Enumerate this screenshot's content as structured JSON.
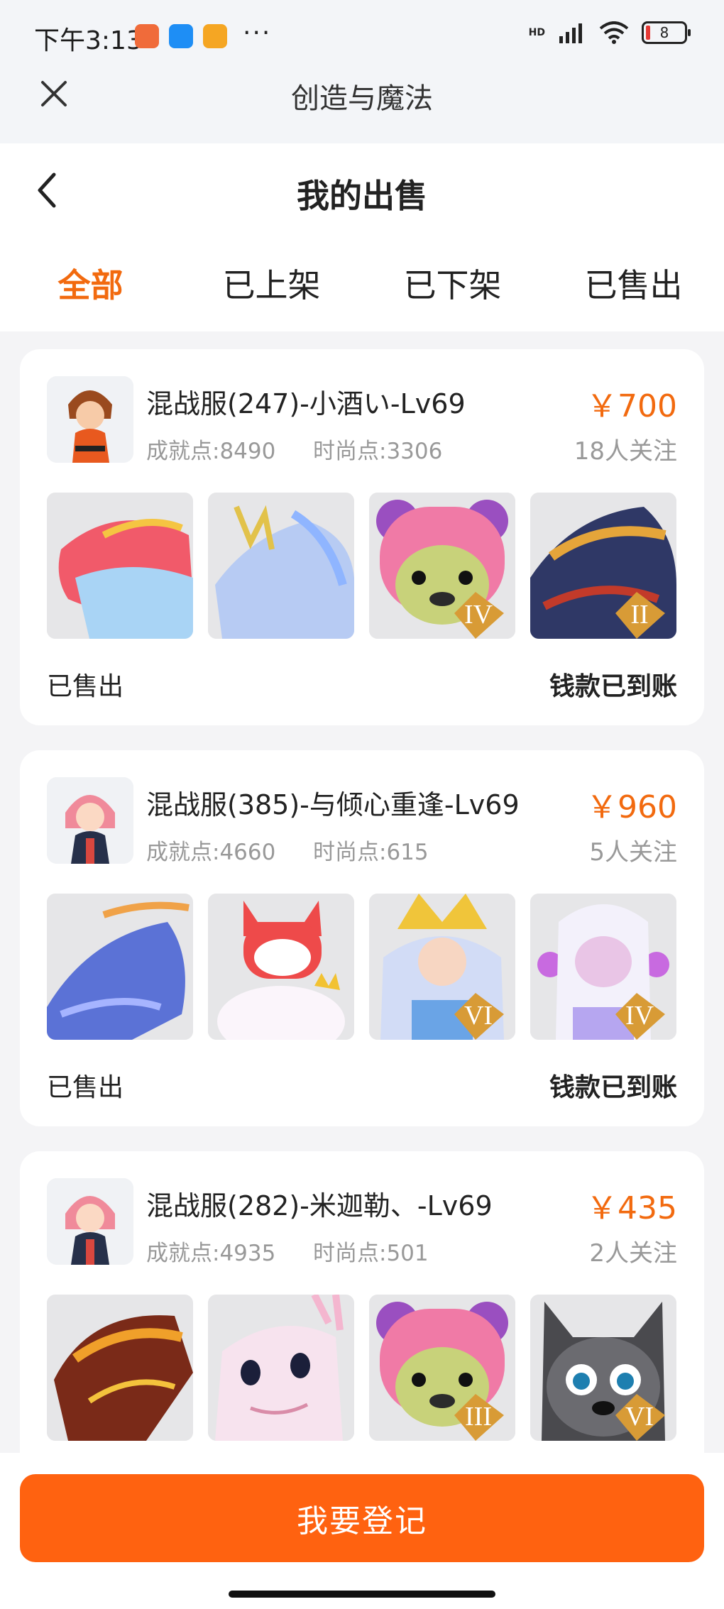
{
  "status_bar": {
    "time": "下午3:13",
    "more": "···",
    "network": "HD",
    "battery": "8"
  },
  "app_bar": {
    "title": "创造与魔法"
  },
  "page": {
    "title": "我的出售"
  },
  "tabs": [
    {
      "label": "全部",
      "active": true
    },
    {
      "label": "已上架",
      "active": false
    },
    {
      "label": "已下架",
      "active": false
    },
    {
      "label": "已售出",
      "active": false
    }
  ],
  "listings": [
    {
      "name": "混战服(247)-小酒い-Lv69",
      "achievement": "成就点:8490",
      "fashion": "时尚点:3306",
      "price": "￥700",
      "followers": "18人关注",
      "status": "已售出",
      "payment": "钱款已到账",
      "items": [
        "dragon-mount",
        "light-horse-mount",
        "pink-bear-pet",
        "dark-dragon-mount"
      ],
      "badges": [
        "",
        "",
        "IV",
        "II"
      ]
    },
    {
      "name": "混战服(385)-与倾心重逢-Lv69",
      "achievement": "成就点:4660",
      "fashion": "时尚点:615",
      "price": "￥960",
      "followers": "5人关注",
      "status": "已售出",
      "payment": "钱款已到账",
      "items": [
        "blue-dragon-mount",
        "fox-cloud-pet",
        "golden-crown-pet",
        "white-doll-pet"
      ],
      "badges": [
        "",
        "",
        "VI",
        "IV"
      ]
    },
    {
      "name": "混战服(282)-米迦勒、-Lv69",
      "achievement": "成就点:4935",
      "fashion": "时尚点:501",
      "price": "￥435",
      "followers": "2人关注",
      "status": "",
      "payment": "",
      "items": [
        "fire-dragon-mount",
        "pink-axolotl-pet",
        "pink-bear-pet",
        "grey-wolf-pet"
      ],
      "badges": [
        "",
        "",
        "III",
        "VI"
      ]
    }
  ],
  "register_button": "我要登记",
  "colors": {
    "accent": "#f26a0f",
    "button": "#ff6210",
    "muted": "#999999"
  }
}
